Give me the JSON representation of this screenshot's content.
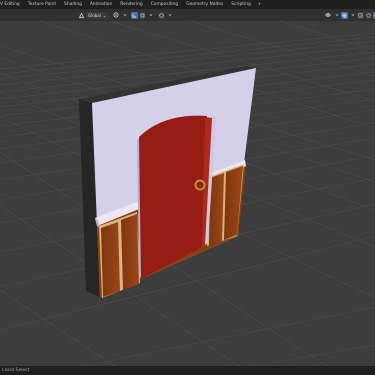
{
  "workspace_tabs": [
    {
      "label": "V Editing"
    },
    {
      "label": "Texture Paint"
    },
    {
      "label": "Shading"
    },
    {
      "label": "Animation"
    },
    {
      "label": "Rendering"
    },
    {
      "label": "Compositing"
    },
    {
      "label": "Geometry Nodes"
    },
    {
      "label": "Scripting"
    },
    {
      "label": "+"
    }
  ],
  "header": {
    "transform_orientation": "Global",
    "orientation_chevron": "⌄"
  },
  "status": {
    "left_text": "Lasso Select"
  },
  "colors": {
    "background": "#3d3d3d",
    "grid_line": "#4d4d4d",
    "wall_face": "#d4d0ea",
    "door_red": "#971c14",
    "panel_brown": "#8b3d12",
    "trim_cream": "#f2d6a4",
    "knob_gold": "#c2902c",
    "active_blue": "#4772b3"
  }
}
